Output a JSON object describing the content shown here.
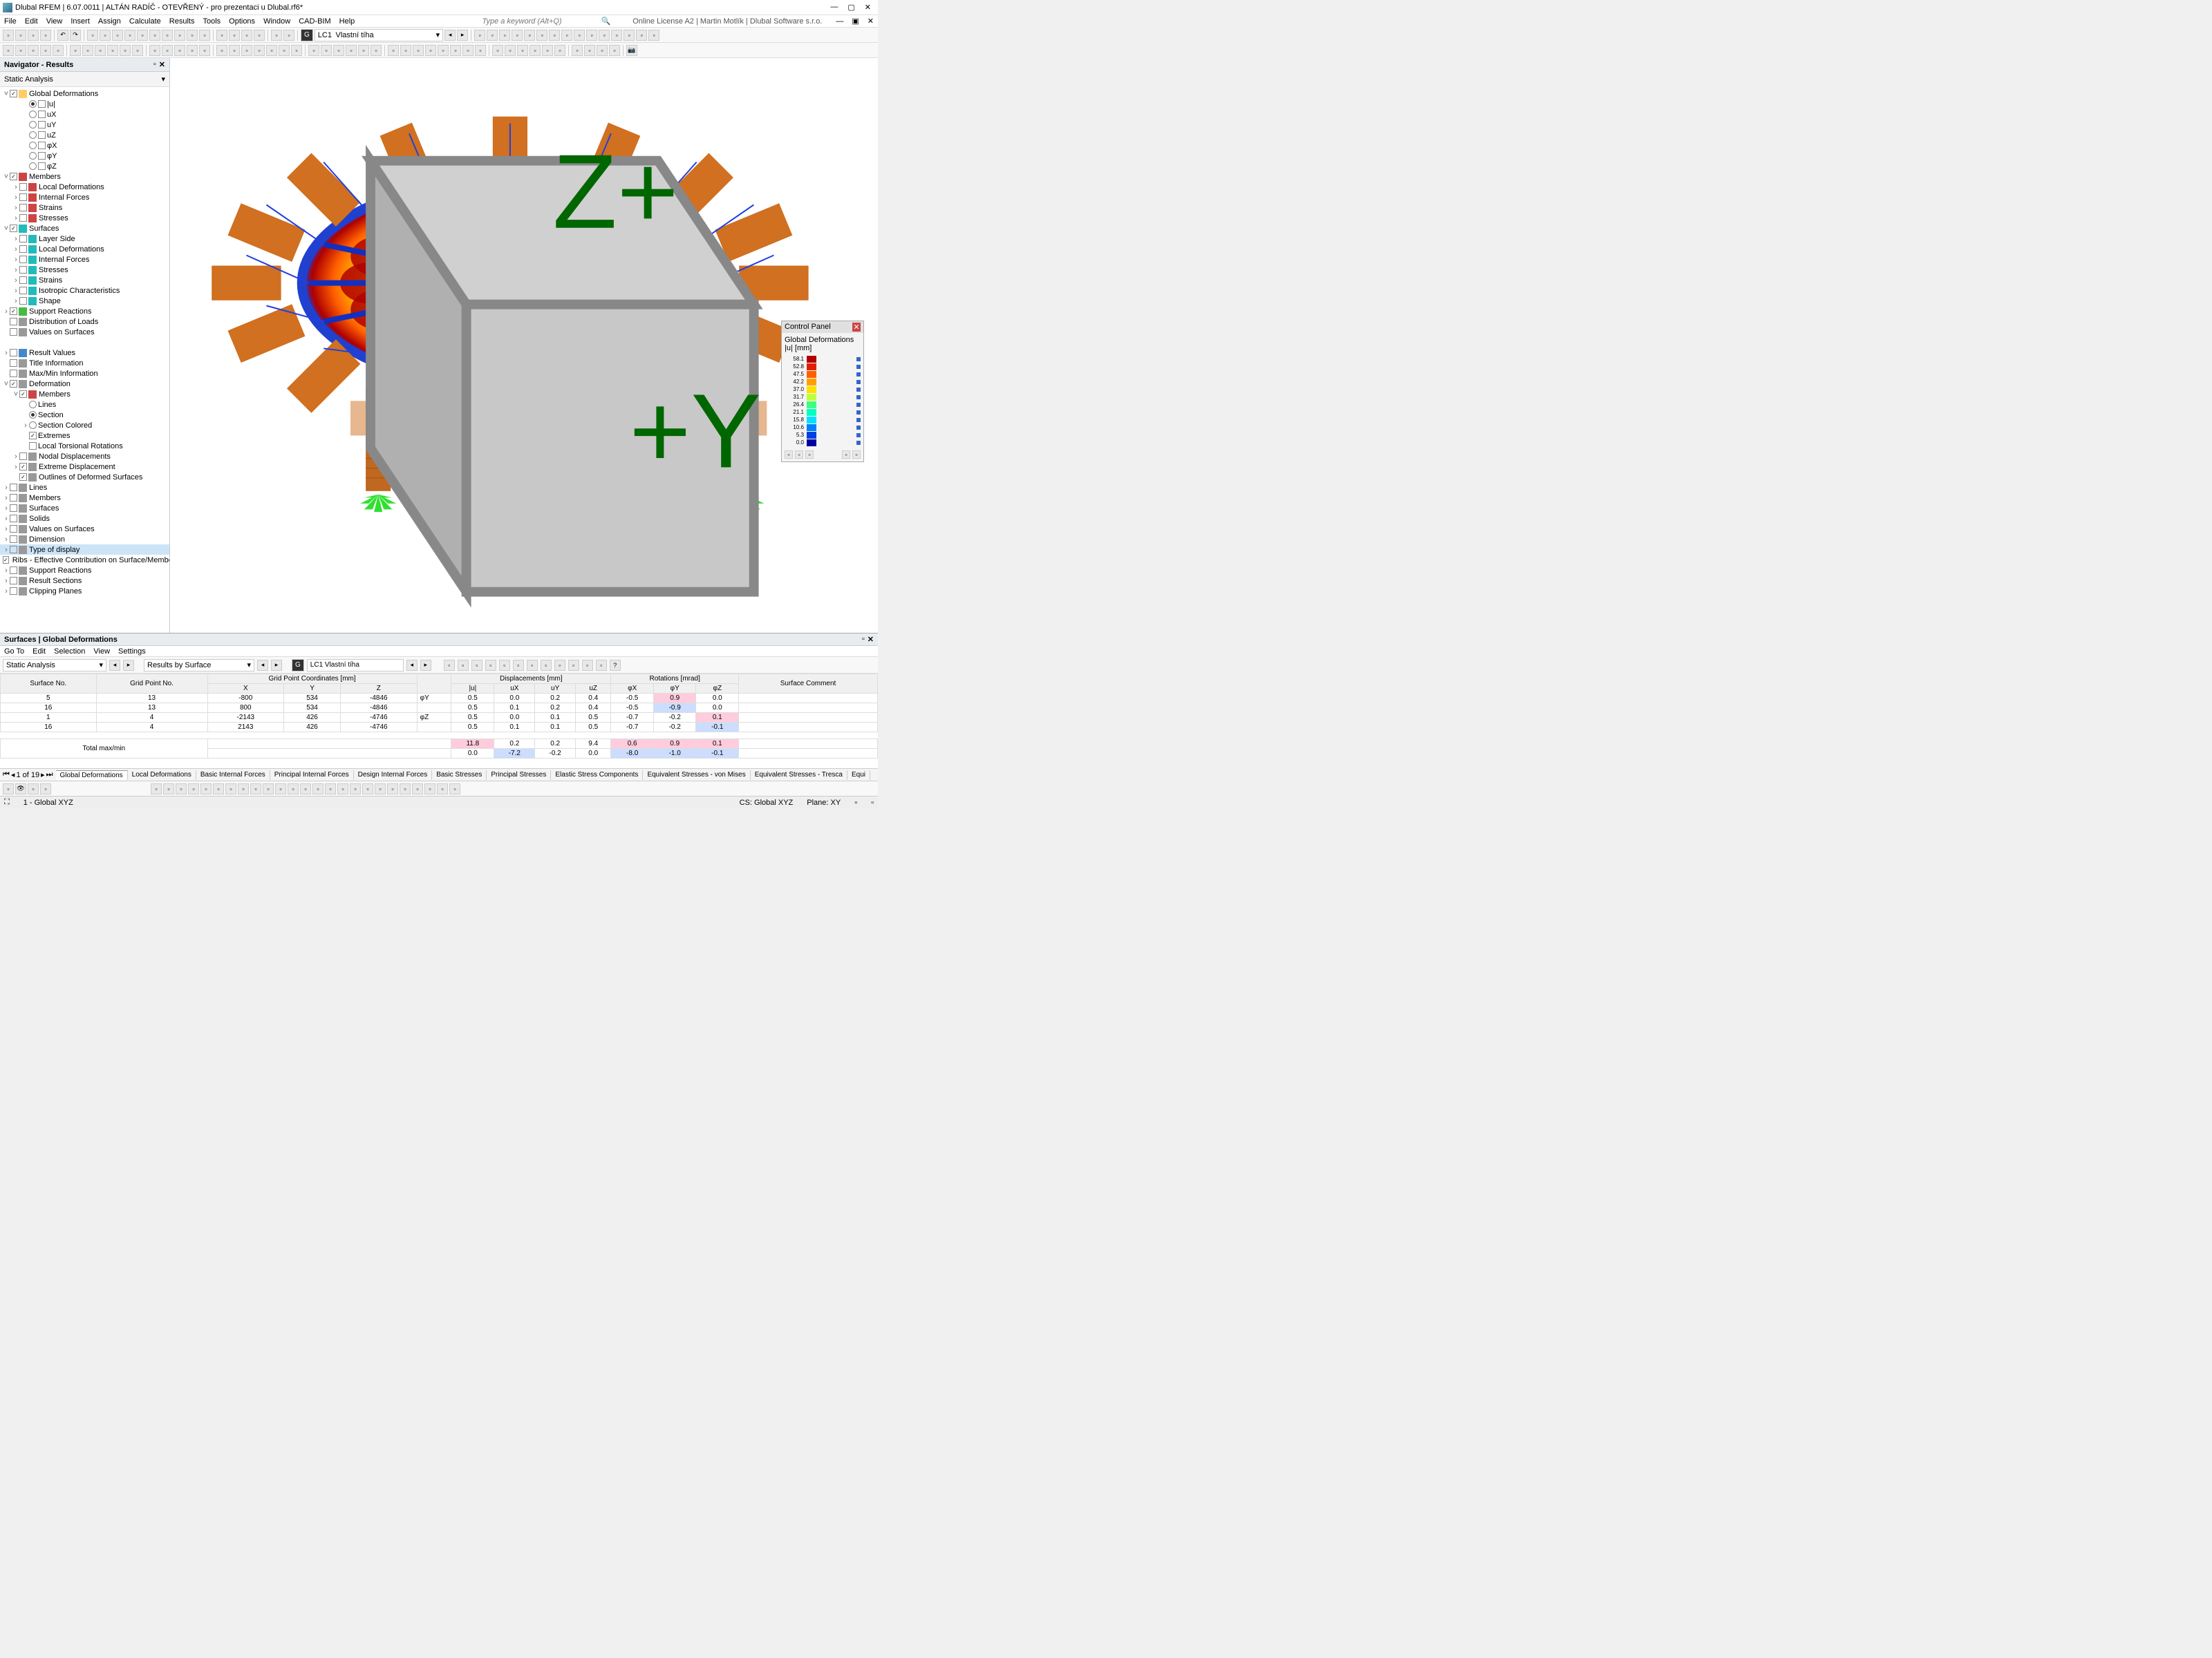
{
  "window": {
    "title": "Dlubal RFEM | 6.07.0011 | ALTÁN RADÍČ - OTEVŘENÝ - pro prezentaci u Dlubal.rf6*",
    "license": "Online License A2 | Martin Motlík | Dlubal Software s.r.o."
  },
  "menubar": [
    "File",
    "Edit",
    "View",
    "Insert",
    "Assign",
    "Calculate",
    "Results",
    "Tools",
    "Options",
    "Window",
    "CAD-BIM",
    "Help"
  ],
  "keyword_placeholder": "Type a keyword (Alt+Q)",
  "toolbar_combo": {
    "g": "G",
    "lc": "LC1",
    "label": "Vlastní tíha"
  },
  "nav": {
    "title": "Navigator - Results",
    "combo": "Static Analysis",
    "tree": [
      {
        "d": 0,
        "tw": "˅",
        "cb": "✓",
        "ico": "folder",
        "t": "Global Deformations"
      },
      {
        "d": 2,
        "rb": "on",
        "sq": 1,
        "t": "|u|"
      },
      {
        "d": 2,
        "rb": "",
        "sq": 1,
        "t": "uX"
      },
      {
        "d": 2,
        "rb": "",
        "sq": 1,
        "t": "uY"
      },
      {
        "d": 2,
        "rb": "",
        "sq": 1,
        "t": "uZ"
      },
      {
        "d": 2,
        "rb": "",
        "sq": 1,
        "t": "φX"
      },
      {
        "d": 2,
        "rb": "",
        "sq": 1,
        "t": "φY"
      },
      {
        "d": 2,
        "rb": "",
        "sq": 1,
        "t": "φZ"
      },
      {
        "d": 0,
        "tw": "˅",
        "cb": "✓",
        "ico": "red",
        "t": "Members"
      },
      {
        "d": 1,
        "tw": "›",
        "cb": "",
        "ico": "red",
        "t": "Local Deformations"
      },
      {
        "d": 1,
        "tw": "›",
        "cb": "",
        "ico": "red",
        "t": "Internal Forces"
      },
      {
        "d": 1,
        "tw": "›",
        "cb": "",
        "ico": "red",
        "t": "Strains"
      },
      {
        "d": 1,
        "tw": "›",
        "cb": "",
        "ico": "red",
        "t": "Stresses"
      },
      {
        "d": 0,
        "tw": "˅",
        "cb": "✓",
        "ico": "teal",
        "t": "Surfaces"
      },
      {
        "d": 1,
        "tw": "›",
        "cb": "",
        "ico": "teal",
        "t": "Layer Side"
      },
      {
        "d": 1,
        "tw": "›",
        "cb": "",
        "ico": "teal",
        "t": "Local Deformations"
      },
      {
        "d": 1,
        "tw": "›",
        "cb": "",
        "ico": "teal",
        "t": "Internal Forces"
      },
      {
        "d": 1,
        "tw": "›",
        "cb": "",
        "ico": "teal",
        "t": "Stresses"
      },
      {
        "d": 1,
        "tw": "›",
        "cb": "",
        "ico": "teal",
        "t": "Strains"
      },
      {
        "d": 1,
        "tw": "›",
        "cb": "",
        "ico": "teal",
        "t": "Isotropic Characteristics"
      },
      {
        "d": 1,
        "tw": "›",
        "cb": "",
        "ico": "teal",
        "t": "Shape"
      },
      {
        "d": 0,
        "tw": "›",
        "cb": "✓",
        "ico": "green",
        "t": "Support Reactions"
      },
      {
        "d": 0,
        "tw": "",
        "cb": "",
        "ico": "gray",
        "t": "Distribution of Loads"
      },
      {
        "d": 0,
        "tw": "",
        "cb": "",
        "ico": "gray",
        "t": "Values on Surfaces"
      },
      {
        "d": 0,
        "tw": "",
        "t": ""
      },
      {
        "d": 0,
        "tw": "›",
        "cb": "",
        "ico": "blue",
        "t": "Result Values"
      },
      {
        "d": 0,
        "tw": "",
        "cb": "",
        "ico": "gray",
        "t": "Title Information"
      },
      {
        "d": 0,
        "tw": "",
        "cb": "",
        "ico": "gray",
        "t": "Max/Min Information"
      },
      {
        "d": 0,
        "tw": "˅",
        "cb": "✓",
        "ico": "gray",
        "t": "Deformation"
      },
      {
        "d": 1,
        "tw": "˅",
        "cb": "✓",
        "ico": "red",
        "t": "Members"
      },
      {
        "d": 2,
        "rb": "",
        "t": "Lines"
      },
      {
        "d": 2,
        "rb": "on",
        "t": "Section"
      },
      {
        "d": 2,
        "tw": "›",
        "rb": "",
        "t": "Section Colored"
      },
      {
        "d": 2,
        "cb": "✓",
        "t": "Extremes"
      },
      {
        "d": 2,
        "cb": "",
        "t": "Local Torsional Rotations"
      },
      {
        "d": 1,
        "tw": "›",
        "cb": "",
        "ico": "gray",
        "t": "Nodal Displacements"
      },
      {
        "d": 1,
        "tw": "›",
        "cb": "✓",
        "ico": "gray",
        "t": "Extreme Displacement"
      },
      {
        "d": 1,
        "cb": "✓",
        "ico": "gray",
        "t": "Outlines of Deformed Surfaces"
      },
      {
        "d": 0,
        "tw": "›",
        "cb": "",
        "ico": "gray",
        "t": "Lines"
      },
      {
        "d": 0,
        "tw": "›",
        "cb": "",
        "ico": "gray",
        "t": "Members"
      },
      {
        "d": 0,
        "tw": "›",
        "cb": "",
        "ico": "gray",
        "t": "Surfaces"
      },
      {
        "d": 0,
        "tw": "›",
        "cb": "",
        "ico": "gray",
        "t": "Solids"
      },
      {
        "d": 0,
        "tw": "›",
        "cb": "",
        "ico": "gray",
        "t": "Values on Surfaces"
      },
      {
        "d": 0,
        "tw": "›",
        "cb": "",
        "ico": "gray",
        "t": "Dimension"
      },
      {
        "d": 0,
        "tw": "›",
        "cb": "",
        "ico": "gray",
        "t": "Type of display",
        "sel": true
      },
      {
        "d": 0,
        "tw": "",
        "cb": "✓",
        "ico": "gray",
        "t": "Ribs - Effective Contribution on Surface/Member"
      },
      {
        "d": 0,
        "tw": "›",
        "cb": "",
        "ico": "gray",
        "t": "Support Reactions"
      },
      {
        "d": 0,
        "tw": "›",
        "cb": "",
        "ico": "gray",
        "t": "Result Sections"
      },
      {
        "d": 0,
        "tw": "›",
        "cb": "",
        "ico": "gray",
        "t": "Clipping Planes"
      }
    ]
  },
  "control_panel": {
    "title": "Control Panel",
    "sub1": "Global Deformations",
    "sub2": "|u| [mm]",
    "legend": [
      {
        "v": "58.1",
        "c": "#b00000"
      },
      {
        "v": "52.8",
        "c": "#e02000"
      },
      {
        "v": "47.5",
        "c": "#ff6000"
      },
      {
        "v": "42.2",
        "c": "#ffa000"
      },
      {
        "v": "37.0",
        "c": "#ffe000"
      },
      {
        "v": "31.7",
        "c": "#c0ff40"
      },
      {
        "v": "26.4",
        "c": "#40ff80"
      },
      {
        "v": "21.1",
        "c": "#00ffc0"
      },
      {
        "v": "15.8",
        "c": "#00e0ff"
      },
      {
        "v": "10.6",
        "c": "#0080ff"
      },
      {
        "v": "5.3",
        "c": "#0040e0"
      },
      {
        "v": "0.0",
        "c": "#0000a0"
      }
    ]
  },
  "results": {
    "title": "Surfaces | Global Deformations",
    "menu": [
      "Go To",
      "Edit",
      "Selection",
      "View",
      "Settings"
    ],
    "combo1": "Static Analysis",
    "combo2": "Results by Surface",
    "combo3_g": "G",
    "combo3": "LC1  Vlastní tíha",
    "headers": {
      "surface": "Surface No.",
      "grid": "Grid Point No.",
      "coords": "Grid Point Coordinates [mm]",
      "x": "X",
      "y": "Y",
      "z": "Z",
      "disp": "Displacements [mm]",
      "u": "|u|",
      "ux": "uX",
      "uy": "uY",
      "uz": "uZ",
      "rot": "Rotations [mrad]",
      "px": "φX",
      "py": "φY",
      "pz": "φZ",
      "comment": "Surface Comment"
    },
    "rows": [
      {
        "s": "5",
        "g": "13",
        "x": "-800",
        "y": "534",
        "z": "-4846",
        "zn": "φY",
        "u": "0.5",
        "ux": "0.0",
        "uy": "0.2",
        "uz": "0.4",
        "px": "-0.5",
        "py": "0.9",
        "pyc": "pink",
        "pz": "0.0"
      },
      {
        "s": "16",
        "g": "13",
        "x": "800",
        "y": "534",
        "z": "-4846",
        "zn": "",
        "u": "0.5",
        "ux": "0.1",
        "uy": "0.2",
        "uz": "0.4",
        "px": "-0.5",
        "py": "-0.9",
        "pyc": "blue",
        "pz": "0.0"
      },
      {
        "s": "1",
        "g": "4",
        "x": "-2143",
        "y": "426",
        "z": "-4746",
        "zn": "φZ",
        "u": "0.5",
        "ux": "0.0",
        "uy": "0.1",
        "uz": "0.5",
        "px": "-0.7",
        "py": "-0.2",
        "pz": "0.1",
        "pzc": "pink"
      },
      {
        "s": "16",
        "g": "4",
        "x": "2143",
        "y": "426",
        "z": "-4746",
        "zn": "",
        "u": "0.5",
        "ux": "0.1",
        "uy": "0.1",
        "uz": "0.5",
        "px": "-0.7",
        "py": "-0.2",
        "pz": "-0.1",
        "pzc": "blue"
      }
    ],
    "total_label": "Total max/min",
    "total": {
      "u": "11.8",
      "ux": "0.2",
      "uy": "0.2",
      "uz": "9.4",
      "px": "0.6",
      "py": "0.9",
      "pz": "0.1"
    },
    "total2": {
      "u": "0.0",
      "ux": "-7.2",
      "uy": "-0.2",
      "uz": "0.0",
      "px": "-8.0",
      "py": "-1.0",
      "pz": "-0.1"
    },
    "pager": "1 of 19",
    "tabs": [
      "Global Deformations",
      "Local Deformations",
      "Basic Internal Forces",
      "Principal Internal Forces",
      "Design Internal Forces",
      "Basic Stresses",
      "Principal Stresses",
      "Elastic Stress Components",
      "Equivalent Stresses - von Mises",
      "Equivalent Stresses - Tresca",
      "Equi"
    ]
  },
  "statusbar": {
    "coord": "1 - Global XYZ",
    "cs": "CS: Global XYZ",
    "plane": "Plane: XY"
  }
}
